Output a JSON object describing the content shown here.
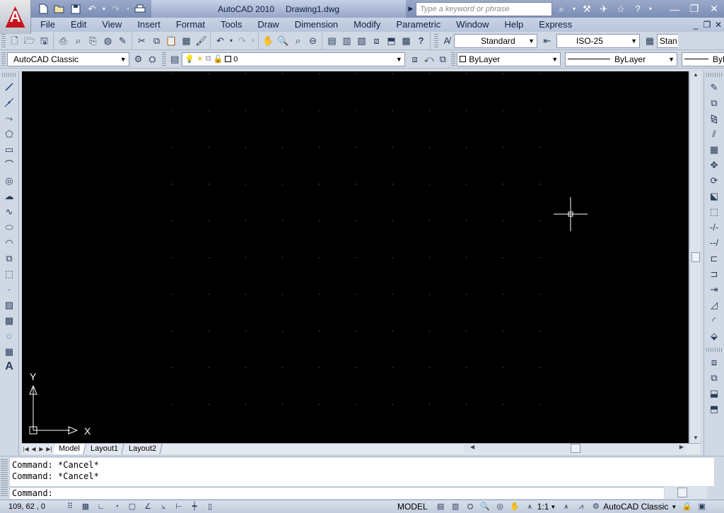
{
  "app": {
    "product": "AutoCAD 2010",
    "document": "Drawing1.dwg",
    "logo_letter": "A"
  },
  "quick_access": [
    "new-icon",
    "open-icon",
    "save-icon",
    "undo-icon",
    "redo-icon",
    "plot-icon"
  ],
  "search": {
    "placeholder": "Type a keyword or phrase"
  },
  "menus": [
    "File",
    "Edit",
    "View",
    "Insert",
    "Format",
    "Tools",
    "Draw",
    "Dimension",
    "Modify",
    "Parametric",
    "Window",
    "Help",
    "Express"
  ],
  "toolbar1": {
    "text_style": "Standard",
    "dim_style": "ISO-25",
    "table_style_partial": "Stan"
  },
  "toolbar2": {
    "workspace": "AutoCAD Classic",
    "layer": "0",
    "color": "ByLayer",
    "linetype": "ByLayer",
    "lineweight_partial": "ByL"
  },
  "ucs": {
    "x_label": "X",
    "y_label": "Y"
  },
  "layout_tabs": [
    "Model",
    "Layout1",
    "Layout2"
  ],
  "command": {
    "history": [
      "Command: *Cancel*",
      "Command: *Cancel*"
    ],
    "prompt": "Command:"
  },
  "status": {
    "coords": "109, 62 , 0",
    "space": "MODEL",
    "annotation_scale": "1:1",
    "workspace": "AutoCAD Classic"
  }
}
